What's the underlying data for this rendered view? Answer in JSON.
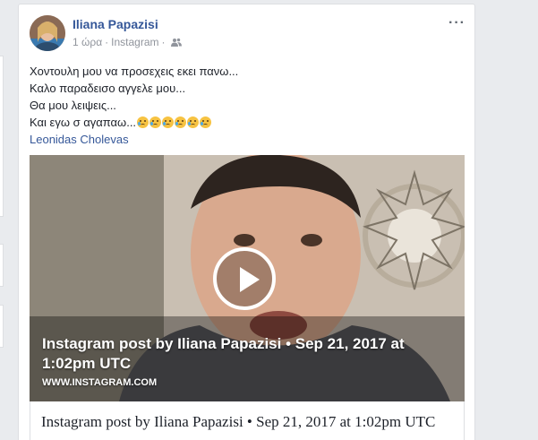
{
  "post": {
    "author": "Iliana Papazisi",
    "time": "1 ώρα",
    "separator": "·",
    "source": "Instagram",
    "audience_icon": "friends-icon",
    "lines": [
      "Χοντουλη μου να προσεχεις εκει πανω...",
      "Καλο παραδεισο αγγελε μου...",
      "Θα μου λειψεις...",
      "Και εγω σ αγαπαω..."
    ],
    "emoji_count": 6,
    "emoji_icon": "crying-face-icon",
    "mention": "Leonidas Cholevas",
    "more_label": "···"
  },
  "media": {
    "overlay_title": "Instagram post by Iliana Papazisi • Sep 21, 2017 at 1:02pm UTC",
    "overlay_domain": "WWW.INSTAGRAM.COM",
    "play_icon": "play-icon"
  },
  "link_caption": "Instagram post by Iliana Papazisi • Sep 21, 2017 at 1:02pm UTC",
  "colors": {
    "link": "#365899",
    "meta": "#90949c",
    "background": "#e9ebee"
  }
}
